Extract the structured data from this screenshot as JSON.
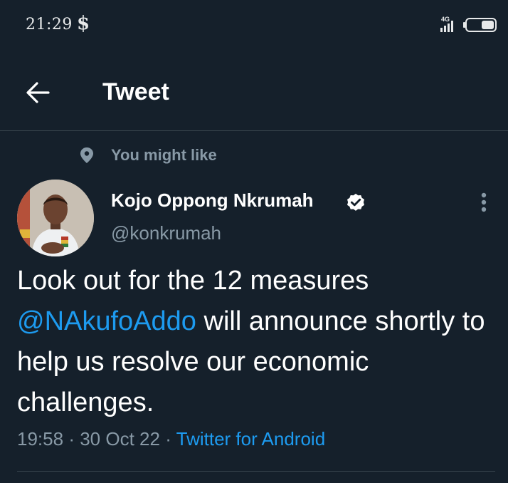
{
  "status_bar": {
    "time": "21:29",
    "network": "4G",
    "app_icon": "dollar-icon",
    "signal_icon": "signal-bars-icon",
    "battery_icon": "battery-icon"
  },
  "header": {
    "back_icon": "arrow-left-icon",
    "title": "Tweet"
  },
  "context": {
    "icon": "location-pin-icon",
    "label": "You might like"
  },
  "tweet": {
    "author": {
      "display_name": "Kojo Oppong Nkrumah",
      "handle": "@konkrumah",
      "verified_icon": "verified-badge-icon",
      "avatar_icon": "avatar"
    },
    "more_icon": "more-vertical-icon",
    "text": {
      "part1": "Look out for the 12 measures ",
      "mention": "@NAkufoAddo",
      "part2": " will announce shortly to help us resolve our economic challenges."
    },
    "time": "19:58",
    "separator": "·",
    "date": "30 Oct 22",
    "source": "Twitter for Android"
  },
  "colors": {
    "background": "#15202b",
    "text_primary": "#ffffff",
    "text_secondary": "#8899a6",
    "accent": "#1d9bf0",
    "divider": "#38444d"
  }
}
